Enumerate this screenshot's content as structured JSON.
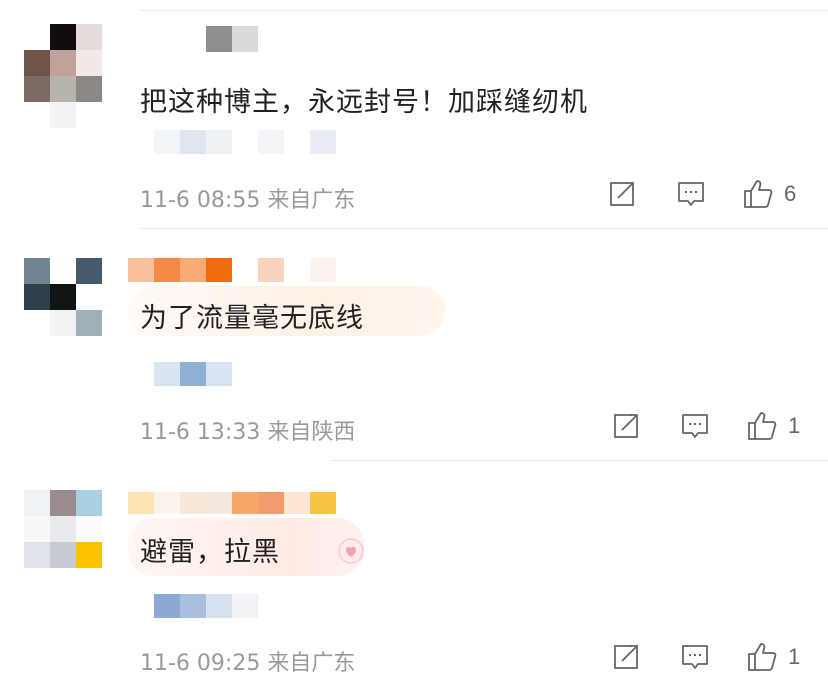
{
  "comments": [
    {
      "text": "把这种博主，永远封号！加踩缝纫机",
      "time": "11-6 08:55",
      "location": "来自广东",
      "likes": "6"
    },
    {
      "text": "为了流量毫无底线",
      "time": "11-6 13:33",
      "location": "来自陕西",
      "likes": "1"
    },
    {
      "text": "避雷，拉黑",
      "time": "11-6 09:25",
      "location": "来自广东",
      "likes": "1"
    }
  ],
  "icons": {
    "share": "share-icon",
    "reply": "comment-icon",
    "like": "thumbs-up-icon"
  },
  "colors": {
    "text": "#222222",
    "meta": "#9a9a9a",
    "icon": "#666666",
    "divider": "#ececec"
  }
}
